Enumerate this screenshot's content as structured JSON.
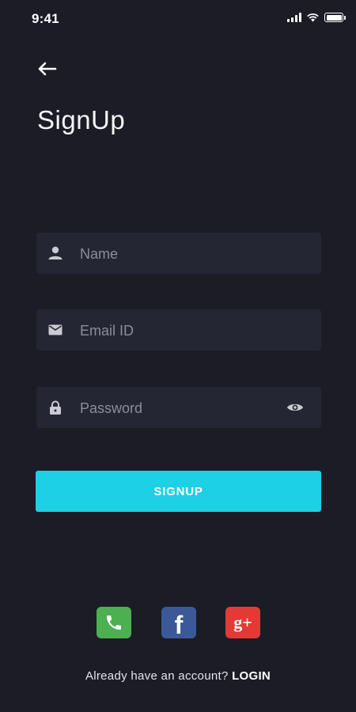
{
  "status_bar": {
    "time": "9:41",
    "icons": [
      "signal-icon",
      "wifi-icon",
      "battery-icon"
    ],
    "battery_level": 1.0
  },
  "header": {
    "back_icon": "arrow-left-icon",
    "title": "SignUp"
  },
  "form": {
    "name": {
      "icon": "person-icon",
      "placeholder": "Name",
      "value": ""
    },
    "email": {
      "icon": "mail-icon",
      "placeholder": "Email ID",
      "value": ""
    },
    "password": {
      "icon": "lock-icon",
      "placeholder": "Password",
      "value": "",
      "toggle_icon": "eye-icon"
    },
    "submit_label": "SIGNUP"
  },
  "social": [
    {
      "name": "phone",
      "icon": "phone-icon",
      "color": "#4caf50"
    },
    {
      "name": "facebook",
      "icon": "facebook-icon",
      "glyph": "f",
      "color": "#3b5998"
    },
    {
      "name": "google-plus",
      "icon": "google-plus-icon",
      "glyph": "g+",
      "color": "#e53935"
    }
  ],
  "footer": {
    "prompt": "Already have an account?",
    "login_label": "LOGIN"
  },
  "colors": {
    "background": "#1b1c26",
    "field_background": "#252633",
    "accent": "#1dd0e4",
    "placeholder": "#8a8d9c"
  }
}
